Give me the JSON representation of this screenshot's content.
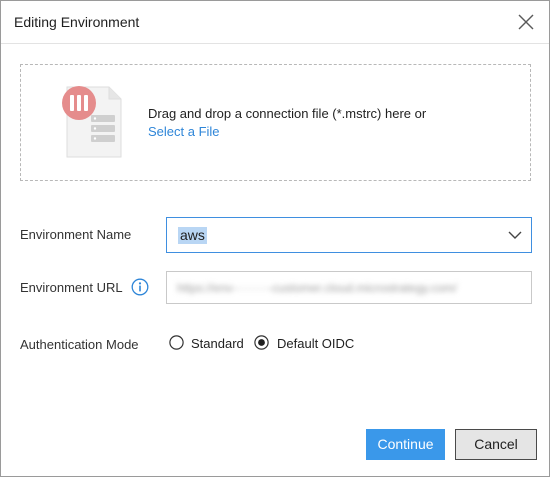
{
  "dialog": {
    "title": "Editing Environment"
  },
  "dropzone": {
    "instruction": "Drag and drop a connection file (*.mstrc) here or",
    "select_link": "Select a File"
  },
  "form": {
    "environment_name": {
      "label": "Environment Name",
      "value": "aws"
    },
    "environment_url": {
      "label": "Environment URL"
    },
    "authentication_mode": {
      "label": "Authentication Mode",
      "options": [
        {
          "label": "Standard",
          "selected": false
        },
        {
          "label": "Default OIDC",
          "selected": true
        }
      ]
    }
  },
  "buttons": {
    "continue": "Continue",
    "cancel": "Cancel"
  },
  "colors": {
    "accent": "#3a98ea",
    "link": "#2f86d8",
    "selection": "#b9d6f4"
  }
}
